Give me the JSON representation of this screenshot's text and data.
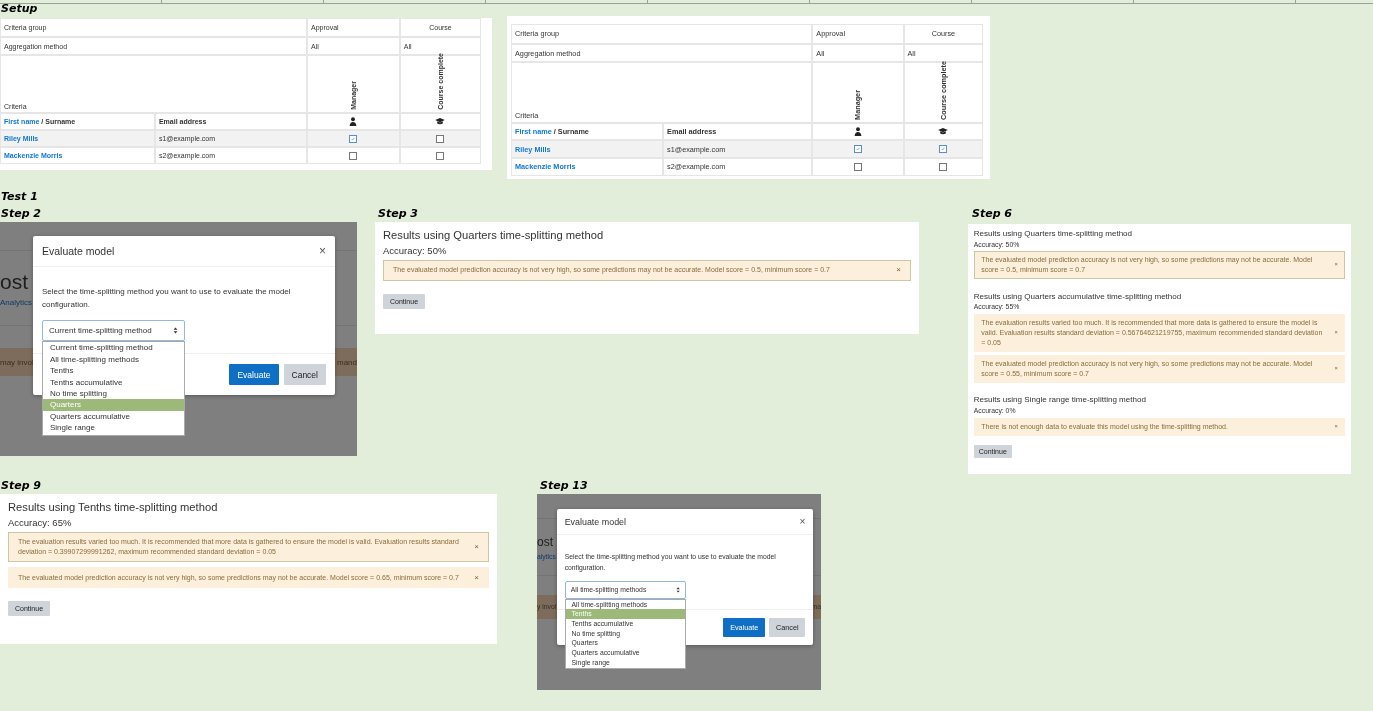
{
  "sections": [
    {
      "title": "Setup",
      "panels": [
        {
          "kind": "criteria_table",
          "criteria_group_label": "Criteria group",
          "groups": [
            "Approval",
            "Course"
          ],
          "aggregation_label": "Aggregation method",
          "aggregations": [
            "All",
            "All"
          ],
          "criteria_label": "Criteria",
          "criteria": [
            {
              "label": "Manager",
              "kind": "role"
            },
            {
              "label": "Course complete",
              "kind": "course"
            }
          ],
          "sort_link": "First name",
          "sort_rest": "/ Surname",
          "email_header": "Email address",
          "students": [
            {
              "name": "Riley Mills",
              "email": "s1@example.com",
              "highlighted": true,
              "completed": [
                true,
                false
              ]
            },
            {
              "name": "Mackenzie Morris",
              "email": "s2@example.com",
              "highlighted": false,
              "completed": [
                false,
                false
              ]
            }
          ]
        },
        {
          "kind": "criteria_table",
          "criteria_group_label": "Criteria group",
          "groups": [
            "Approval",
            "Course"
          ],
          "aggregation_label": "Aggregation method",
          "aggregations": [
            "All",
            "All"
          ],
          "criteria_label": "Criteria",
          "criteria": [
            {
              "label": "Manager",
              "kind": "role"
            },
            {
              "label": "Course complete",
              "kind": "course"
            }
          ],
          "sort_link": "First name",
          "sort_rest": "/ Surname",
          "email_header": "Email address",
          "students": [
            {
              "name": "Riley Mills",
              "email": "s1@example.com",
              "highlighted": true,
              "completed": [
                true,
                true
              ]
            },
            {
              "name": "Mackenzie Morris",
              "email": "s2@example.com",
              "highlighted": false,
              "completed": [
                false,
                false
              ]
            }
          ]
        }
      ]
    },
    {
      "title": "Test 1",
      "panels": [
        {
          "kind": "evaluate_dialog",
          "step": "Step 2",
          "backdrop_heading": "ost",
          "backdrop_link": "Analytics",
          "backdrop_band": [
            "may invol",
            "mand"
          ],
          "title": "Evaluate model",
          "close": "×",
          "message": "Select the time-splitting method you want to use to evaluate the model configuration.",
          "select_value": "Current time-splitting method",
          "options": [
            {
              "label": "Current time-splitting method",
              "selected": false
            },
            {
              "label": "All time-splitting methods",
              "selected": false
            },
            {
              "label": "Tenths",
              "selected": false
            },
            {
              "label": "Tenths accumulative",
              "selected": false
            },
            {
              "label": "No time splitting",
              "selected": false
            },
            {
              "label": "Quarters",
              "selected": true
            },
            {
              "label": "Quarters accumulative",
              "selected": false
            },
            {
              "label": "Single range",
              "selected": false
            }
          ],
          "buttons": [
            {
              "label": "Evaluate",
              "kind": "primary"
            },
            {
              "label": "Cancel",
              "kind": "secondary"
            }
          ]
        },
        {
          "kind": "results",
          "step": "Step 3",
          "results": [
            {
              "title": "Results using Quarters time-splitting method",
              "accuracy": "Accuracy: 50%",
              "alerts": [
                {
                  "text": "The evaluated model prediction accuracy is not very high, so some predictions may not be accurate. Model score = 0.5, minimum score = 0.7",
                  "focused": true,
                  "close": "×"
                }
              ]
            }
          ],
          "continue": "Continue"
        },
        {
          "kind": "results",
          "step": "Step 6",
          "results": [
            {
              "title": "Results using Quarters time-splitting method",
              "accuracy": "Accuracy: 50%",
              "alerts": [
                {
                  "text": "The evaluated model prediction accuracy is not very high, so some predictions may not be accurate. Model score = 0.5, minimum score = 0.7",
                  "focused": true,
                  "close": "×"
                }
              ]
            },
            {
              "title": "Results using Quarters accumulative time-splitting method",
              "accuracy": "Accuracy: 55%",
              "alerts": [
                {
                  "text": "The evaluation results varied too much. It is recommended that more data is gathered to ensure the model is valid. Evaluation results standard deviation = 0.56764621219755, maximum recommended standard deviation = 0.05",
                  "focused": false,
                  "close": "×"
                },
                {
                  "text": "The evaluated model prediction accuracy is not very high, so some predictions may not be accurate. Model score = 0.55, minimum score = 0.7",
                  "focused": false,
                  "close": "×"
                }
              ]
            },
            {
              "title": "Results using Single range time-splitting method",
              "accuracy": "Accuracy: 0%",
              "alerts": [
                {
                  "text": "There is not enough data to evaluate this model using the time-splitting method.",
                  "focused": false,
                  "close": "×"
                }
              ]
            }
          ],
          "continue": "Continue"
        },
        {
          "kind": "results",
          "step": "Step 9",
          "results": [
            {
              "title": "Results using Tenths time-splitting method",
              "accuracy": "Accuracy: 65%",
              "alerts": [
                {
                  "text": "The evaluation results varied too much. It is recommended that more data is gathered to ensure the model is valid. Evaluation results standard deviation = 0.39907299991262, maximum recommended standard deviation = 0.05",
                  "focused": true,
                  "close": "×"
                },
                {
                  "text": "The evaluated model prediction accuracy is not very high, so some predictions may not be accurate. Model score = 0.65, minimum score = 0.7",
                  "focused": false,
                  "close": "×"
                }
              ]
            }
          ],
          "continue": "Continue"
        },
        {
          "kind": "evaluate_dialog",
          "step": "Step 13",
          "backdrop_heading": "ost",
          "backdrop_link": "alytics",
          "backdrop_band": [
            "y invol",
            "ma"
          ],
          "title": "Evaluate model",
          "close": "×",
          "message": "Select the time-splitting method you want to use to evaluate the model configuration.",
          "select_value": "All time-splitting methods",
          "options": [
            {
              "label": "All time-splitting methods",
              "selected": false
            },
            {
              "label": "Tenths",
              "selected": true
            },
            {
              "label": "Tenths accumulative",
              "selected": false
            },
            {
              "label": "No time splitting",
              "selected": false
            },
            {
              "label": "Quarters",
              "selected": false
            },
            {
              "label": "Quarters accumulative",
              "selected": false
            },
            {
              "label": "Single range",
              "selected": false
            }
          ],
          "buttons": [
            {
              "label": "Evaluate",
              "kind": "primary"
            },
            {
              "label": "Cancel",
              "kind": "secondary"
            }
          ]
        }
      ]
    }
  ]
}
